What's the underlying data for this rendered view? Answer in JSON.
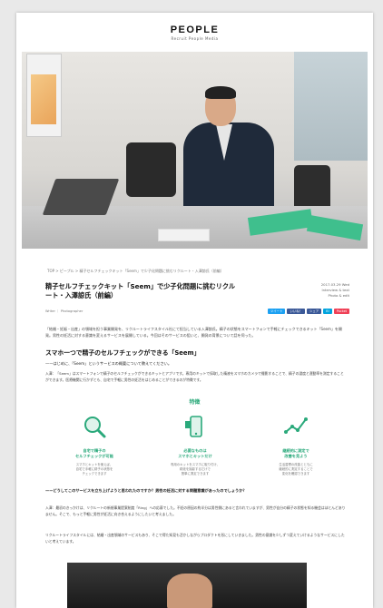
{
  "header": {
    "logo": "PEOPLE",
    "logo_sub": "Recruit People Media"
  },
  "breadcrumb": "TOP > ピープル > 精子セルフチェックキット「Seem」で少子化問題に挑むリクルート・入澤諒氏（前編）",
  "article": {
    "title": "精子セルフチェックキット「Seem」で少子化問題に挑むリクルート・入澤諒氏（前編）",
    "meta": [
      "2017.03.29 Wed",
      "Interview & text",
      "Photo & edit"
    ],
    "byline": "Writer ｜ Photographer",
    "share": [
      {
        "label": "ツイート",
        "color": "#1da1f2"
      },
      {
        "label": "いいね！",
        "color": "#3b5998"
      },
      {
        "label": "シェア",
        "color": "#3b5998"
      },
      {
        "label": "B!",
        "color": "#00a4de"
      },
      {
        "label": "Pocket",
        "color": "#ef4056"
      }
    ],
    "intro": "「結婚・妊娠・出産」の領域を担う事業開発を、リクルートライフスタイル社にて担当している入澤諒氏。精子の状態をスマートフォンで手軽にチェックできるキット「Seem」を開発。男性の妊活に対する意識を変えるサービスを展開している。今回はそのサービスの狙いと、開発の背景について話を伺った。",
    "h2": "スマホ一つで精子のセルフチェックができる「Seem」",
    "q1": "——はじめに、「Seem」というサービスの概要について教えてください。",
    "p1": "入澤：「Seem」はスマートフォンで精子のセルフチェックができるキットとアプリです。専用のキットで採取した精液をスマホのカメラで撮影することで、精子の濃度と運動率を測定することができます。医療機関に行かずとも、自宅で手軽に男性の妊活をはじめることができるのが特徴です。",
    "features_title": "特徴",
    "features": [
      {
        "label": "自宅で精子の\nセルフチェックが可能",
        "desc": "スマホとキットを使えば、\n自宅で手軽に精子の状態を\nチェックできます"
      },
      {
        "label": "必要なものは\nスマホとキットだけ",
        "desc": "専用のキットをスマホに取り付け、\n精液を撮影するだけで\n簡単に測定できます"
      },
      {
        "label": "継続的に測定で\n改善を見よう",
        "desc": "生活習慣の改善とともに\n継続的に測定することで\n変化を確認できます"
      }
    ],
    "q2": "——どうしてこのサービスを立ち上げようと思われたのですか？男性の妊活に対する問題意識があったのでしょうか？",
    "p2": "入澤：最初のきっかけは、リクルートの新規事業提案制度「Ring」への応募でした。不妊の原因の約半分は男性側にあると言われていますが、男性が自分の精子の状態を知る機会はほとんどありません。そこで、もっと手軽に男性が妊活に向き合えるようにしたいと考えました。",
    "p3": "リクルートライフスタイルには、結婚・出産領域のサービスもあり、そこで得た知見も活かしながらプロダクトを形にしていきました。男性の意識を少しずつ変えていけるようなサービスにしたいと考えています。"
  }
}
